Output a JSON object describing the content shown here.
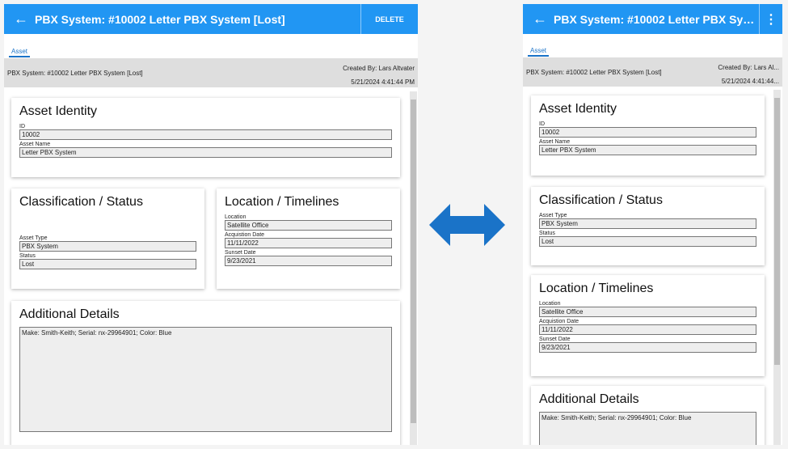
{
  "header": {
    "title": "PBX System: #10002 Letter PBX System [Lost]",
    "title_short": "PBX System: #10002 Letter PBX Syst...",
    "delete_label": "DELETE"
  },
  "tab": "Asset",
  "summary": {
    "name": "PBX System: #10002 Letter PBX System [Lost]",
    "created_by": "Created By: Lars Altvater",
    "created_by_short": "Created By: Lars Al...",
    "date": "5/21/2024 4:41:44 PM",
    "date_short": "5/21/2024 4:41:44..."
  },
  "identity": {
    "title": "Asset Identity",
    "id_label": "ID",
    "id": "10002",
    "name_label": "Asset Name",
    "name": "Letter PBX System"
  },
  "classification": {
    "title": "Classification / Status",
    "type_label": "Asset Type",
    "type": "PBX System",
    "status_label": "Status",
    "status": "Lost"
  },
  "location": {
    "title": "Location / Timelines",
    "loc_label": "Location",
    "loc": "Satellite Office",
    "acq_label": "Acquistion Date",
    "acq": "11/11/2022",
    "sunset_label": "Sunset Date",
    "sunset": "9/23/2021"
  },
  "details": {
    "title": "Additional Details",
    "text": "Make: Smith-Keith; Serial: nx-29964901; Color: Blue"
  },
  "colors": {
    "accent": "#2196f3",
    "arrow": "#1a73c8"
  }
}
